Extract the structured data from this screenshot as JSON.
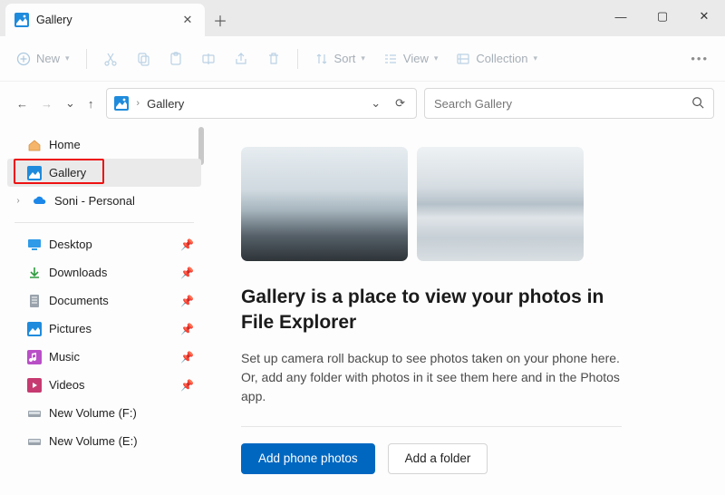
{
  "window": {
    "tab_title": "Gallery",
    "close_tab_glyph": "✕",
    "new_tab_glyph": "＋",
    "minimize_glyph": "—",
    "maximize_glyph": "▢",
    "close_glyph": "✕"
  },
  "toolbar": {
    "new_label": "New",
    "sort_label": "Sort",
    "view_label": "View",
    "collection_label": "Collection"
  },
  "addressbar": {
    "breadcrumb": "Gallery",
    "dropdown_glyph": "⌄",
    "refresh_glyph": "⟳"
  },
  "search": {
    "placeholder": "Search Gallery"
  },
  "nav": {
    "back_glyph": "←",
    "forward_glyph": "→",
    "recent_glyph": "⌄",
    "up_glyph": "↑"
  },
  "sidebar": {
    "home": "Home",
    "gallery": "Gallery",
    "cloud": "Soni - Personal",
    "quick": [
      {
        "label": "Desktop",
        "pinned": true
      },
      {
        "label": "Downloads",
        "pinned": true
      },
      {
        "label": "Documents",
        "pinned": true
      },
      {
        "label": "Pictures",
        "pinned": true
      },
      {
        "label": "Music",
        "pinned": true
      },
      {
        "label": "Videos",
        "pinned": true
      },
      {
        "label": "New Volume (F:)",
        "pinned": false
      },
      {
        "label": "New Volume (E:)",
        "pinned": false
      }
    ]
  },
  "main": {
    "heading": "Gallery is a place to view your photos in File Explorer",
    "body": "Set up camera roll backup to see photos taken on your phone here. Or, add any folder with photos in it see them here and in the Photos app.",
    "primary_btn": "Add phone photos",
    "secondary_btn": "Add a folder"
  }
}
